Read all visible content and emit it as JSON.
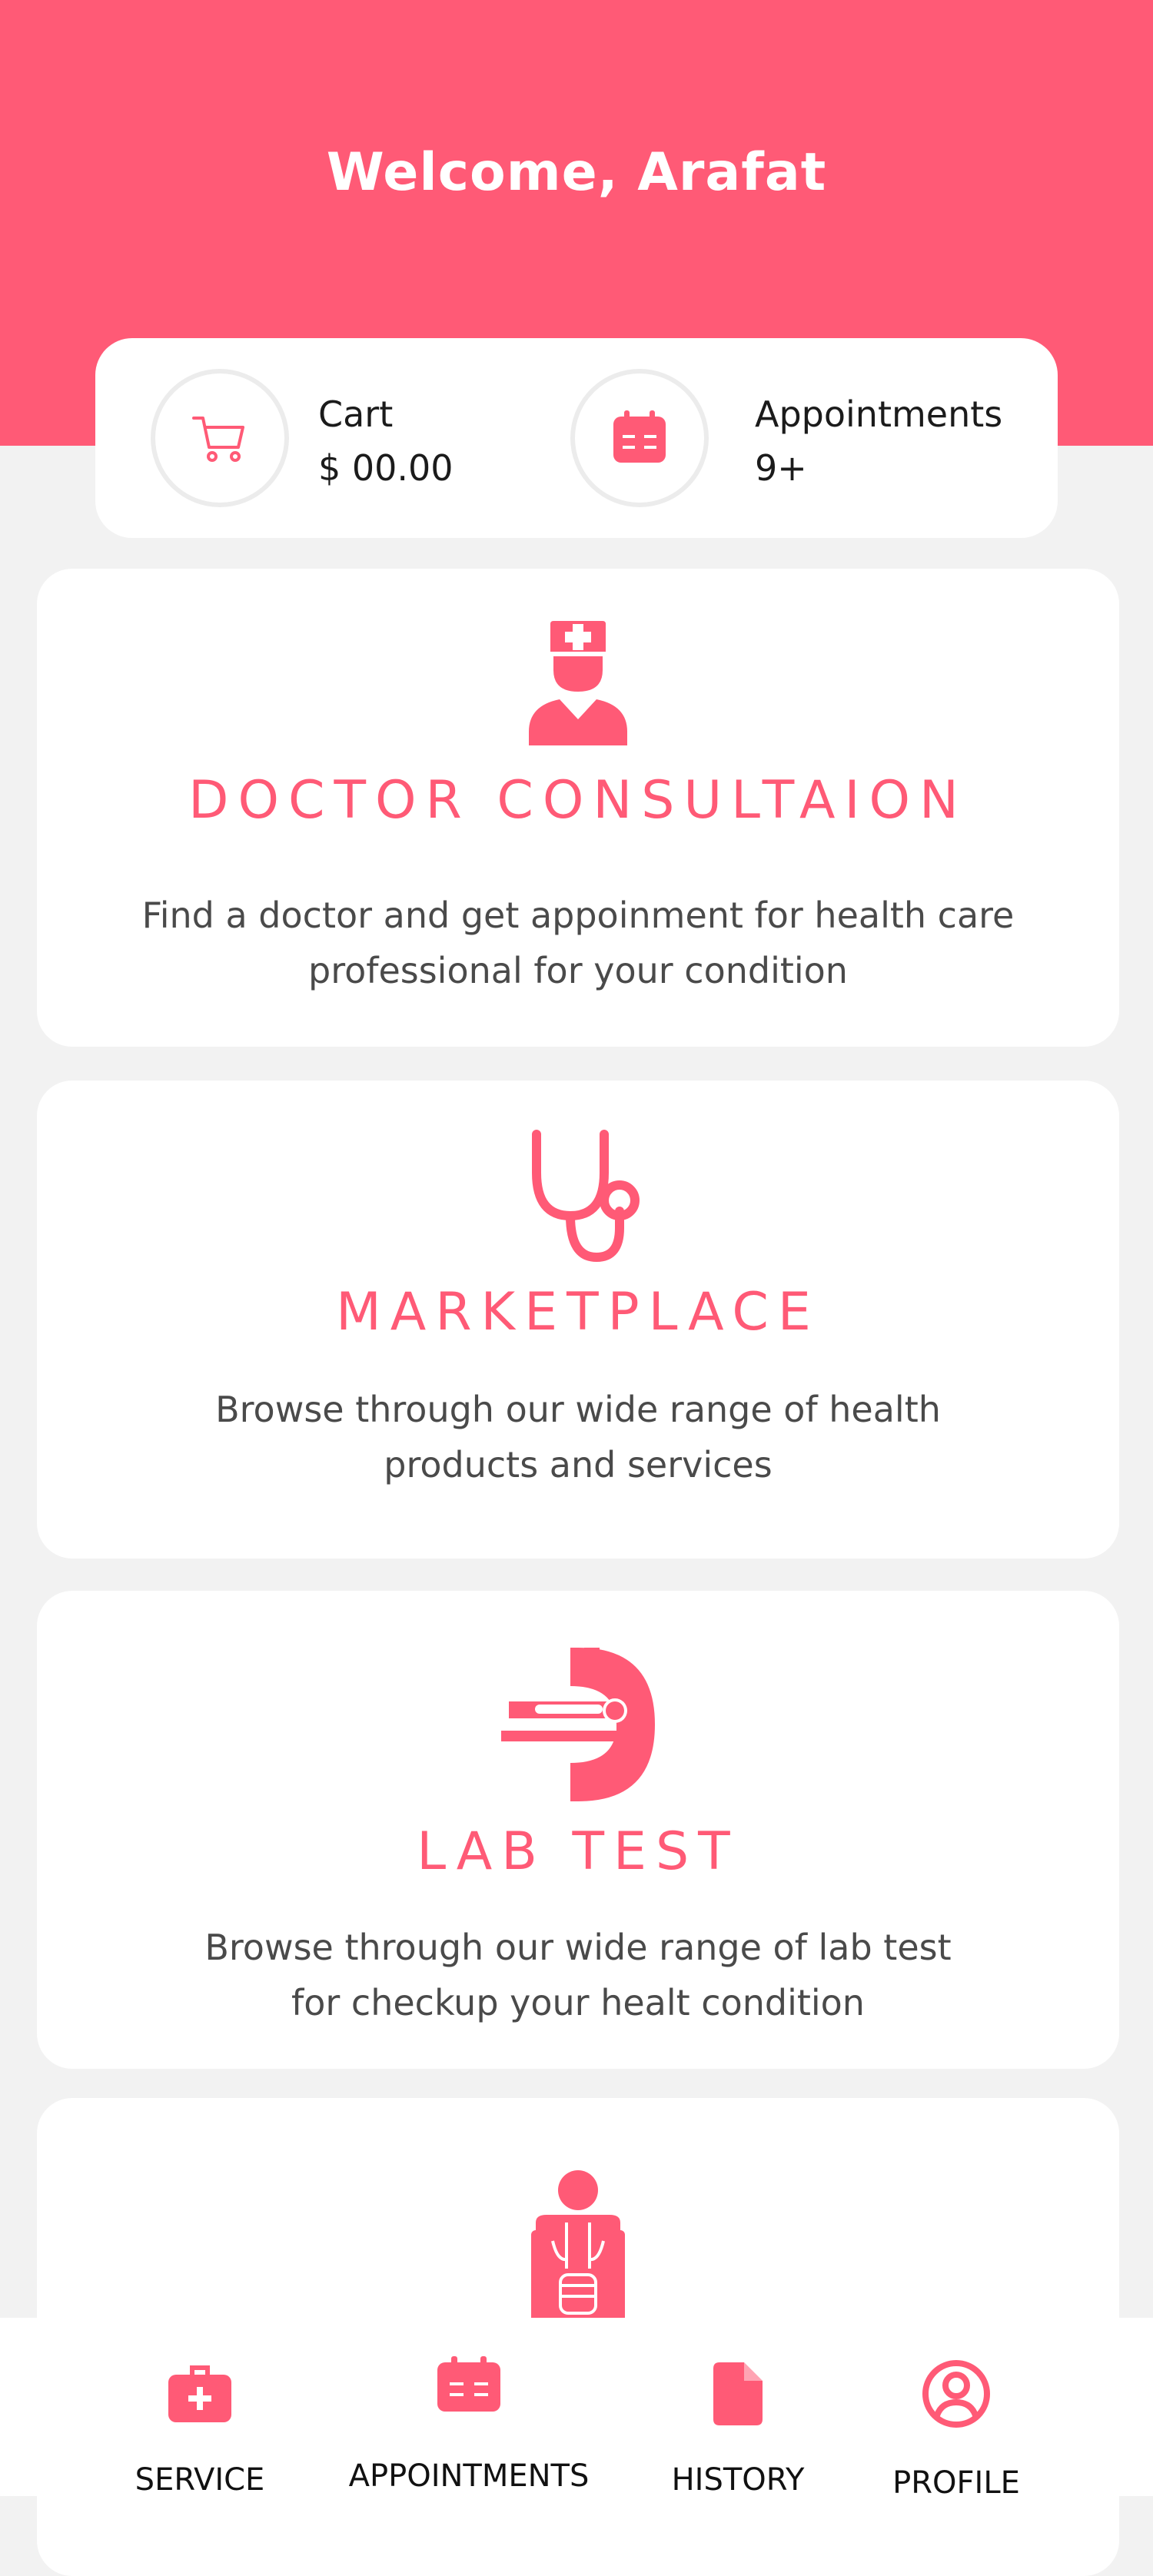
{
  "header": {
    "welcome": "Welcome, Arafat"
  },
  "summary": {
    "cart": {
      "label": "Cart",
      "value": "$ 00.00",
      "icon": "cart-icon"
    },
    "appointments": {
      "label": "Appointments",
      "value": "9+",
      "icon": "calendar-icon"
    }
  },
  "cards": [
    {
      "title": "DOCTOR CONSULTAION",
      "desc_line1": "Find  a doctor and get appoinment for health care",
      "desc_line2": "professional for your condition",
      "icon": "doctor-icon"
    },
    {
      "title": "MARKETPLACE",
      "desc_line1": "Browse through our wide range of health",
      "desc_line2": "products and services",
      "icon": "stethoscope-icon"
    },
    {
      "title": "LAB TEST",
      "desc_line1": "Browse through our wide range of lab test",
      "desc_line2": "for checkup your healt condition",
      "icon": "scanner-icon"
    },
    {
      "title": "",
      "icon": "body-anatomy-icon"
    }
  ],
  "nav": [
    {
      "label": "SERVICE",
      "icon": "medical-kit-icon"
    },
    {
      "label": "APPOINTMENTS",
      "icon": "calendar-icon"
    },
    {
      "label": "HISTORY",
      "icon": "document-icon"
    },
    {
      "label": "PROFILE",
      "icon": "profile-icon"
    }
  ],
  "colors": {
    "accent": "#ff5a76",
    "background": "#f2f2f2",
    "card": "#ffffff",
    "text": "#4a4a4a"
  }
}
